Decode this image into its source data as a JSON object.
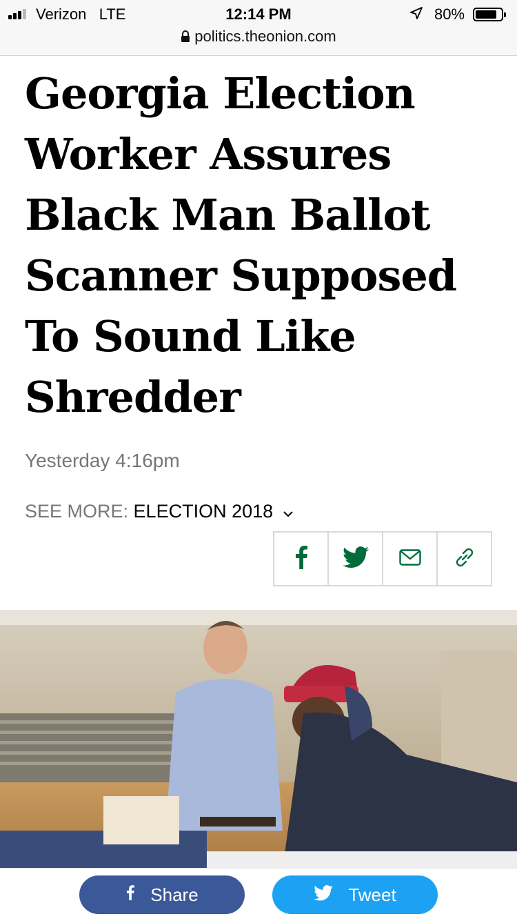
{
  "status_bar": {
    "carrier": "Verizon",
    "network": "LTE",
    "time": "12:14 PM",
    "battery": "80%",
    "battery_level": 0.8,
    "url": "politics.theonion.com"
  },
  "article": {
    "headline": "Georgia Election Worker Assures Black Man Ballot Scanner Supposed To Sound Like Shredder",
    "date": "Yesterday 4:16pm",
    "see_more_label": "SEE MORE:",
    "see_more_topic": "ELECTION 2018",
    "share_icons": [
      "facebook-icon",
      "twitter-icon",
      "email-icon",
      "link-icon"
    ],
    "accent_color": "#006c3b"
  },
  "bottom_bar": {
    "share_label": "Share",
    "tweet_label": "Tweet",
    "share_color": "#3b5998",
    "tweet_color": "#1da1f2"
  }
}
